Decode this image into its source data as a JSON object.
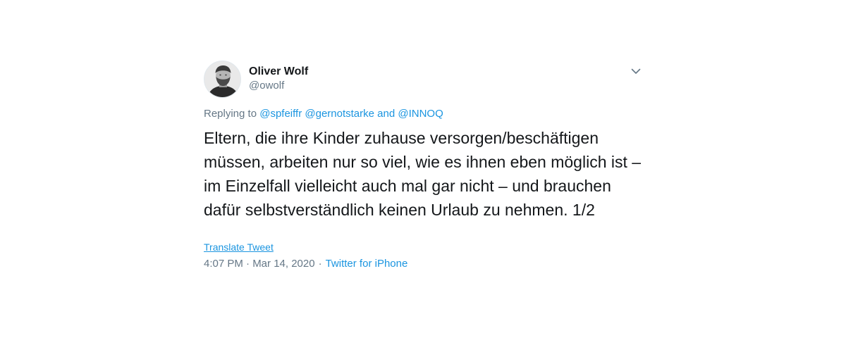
{
  "author": {
    "display_name": "Oliver Wolf",
    "handle": "@owolf"
  },
  "reply_context": {
    "prefix": "Replying to",
    "mentions": [
      "@spfeiffr",
      "@gernotstarke",
      "@INNOQ"
    ],
    "conjunction": "and"
  },
  "tweet": {
    "text": "Eltern, die ihre Kinder zuhause versorgen/beschäftigen müssen, arbeiten nur so viel, wie es ihnen eben möglich ist – im Einzelfall vielleicht auch mal gar nicht – und brauchen dafür selbstverständlich keinen Urlaub zu nehmen. 1/2",
    "translate_label": "Translate Tweet",
    "timestamp": "4:07 PM · Mar 14, 2020",
    "separator": "·",
    "source": "Twitter for iPhone"
  },
  "colors": {
    "link": "#1b95e0",
    "secondary_text": "#657786",
    "primary_text": "#14171a"
  },
  "icons": {
    "menu": "chevron-down-icon"
  }
}
